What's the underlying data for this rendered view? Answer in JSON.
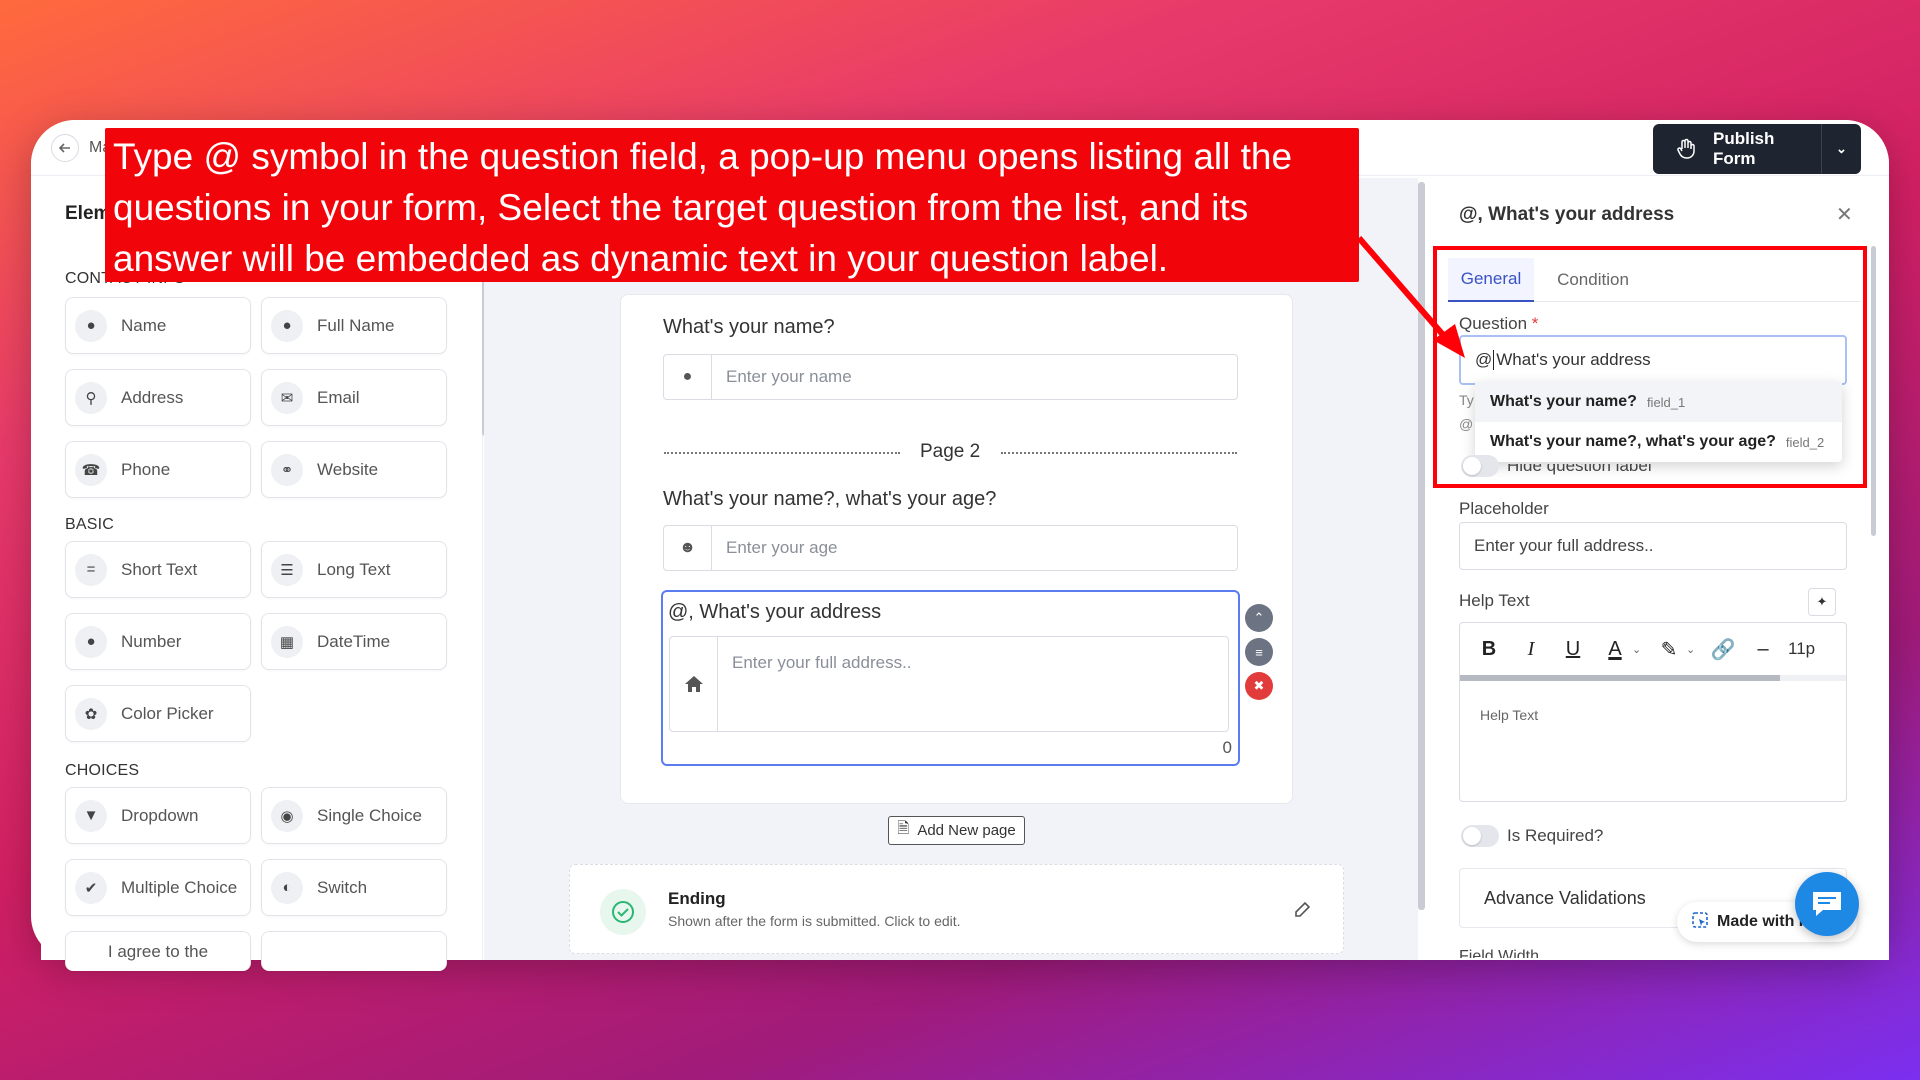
{
  "window": {
    "crumb": "Ma"
  },
  "header": {
    "publish_label": "Publish Form"
  },
  "left_panel": {
    "title": "Elem",
    "sections": {
      "contact": "CONTACT INFO",
      "basic": "BASIC",
      "choices": "CHOICES"
    },
    "elements": {
      "name": "Name",
      "full_name": "Full Name",
      "address": "Address",
      "email": "Email",
      "phone": "Phone",
      "website": "Website",
      "short_text": "Short Text",
      "long_text": "Long Text",
      "number": "Number",
      "datetime": "DateTime",
      "color_picker": "Color Picker",
      "dropdown": "Dropdown",
      "single_choice": "Single Choice",
      "multiple_choice": "Multiple Choice",
      "switch": "Switch",
      "agree": "I agree to the"
    }
  },
  "canvas": {
    "q1": {
      "label": "What's your name?",
      "placeholder": "Enter your name"
    },
    "page_divider": "Page 2",
    "q2": {
      "label": "What's your name?, what's your age?",
      "placeholder": "Enter your age"
    },
    "q3": {
      "label": "@, What's your address",
      "placeholder": "Enter your full address..",
      "counter": "0"
    },
    "add_page": "Add New page",
    "ending": {
      "title": "Ending",
      "subtitle": "Shown after the form is submitted. Click to edit."
    }
  },
  "right_panel": {
    "title": "@, What's your address",
    "tabs": [
      "General",
      "Condition"
    ],
    "question_label": "Question",
    "required_mark": "*",
    "question_value_prefix": "@",
    "question_value_rest": " What's your address",
    "mention_menu": [
      {
        "label": "What's your name?",
        "key": "field_1"
      },
      {
        "label": "What's your name?, what's your age?",
        "key": "field_2"
      }
    ],
    "frag_ty": "Ty",
    "frag_at": "@",
    "hide_label": "Hide question label",
    "placeholder_label": "Placeholder",
    "placeholder_value": "Enter your full address..",
    "help_label": "Help Text",
    "help_placeholder": "Help Text",
    "font_size": "11p",
    "is_required": "Is Required?",
    "advance_validations": "Advance Validations",
    "field_width": "Field Width",
    "made_with": "Made with F"
  },
  "annotation": {
    "callout_text": "Type @ symbol in the question field, a pop-up menu opens listing all the questions in your form, Select the target question from the list, and its answer will be embedded as dynamic text in your question label.",
    "color": "#f2050a"
  }
}
